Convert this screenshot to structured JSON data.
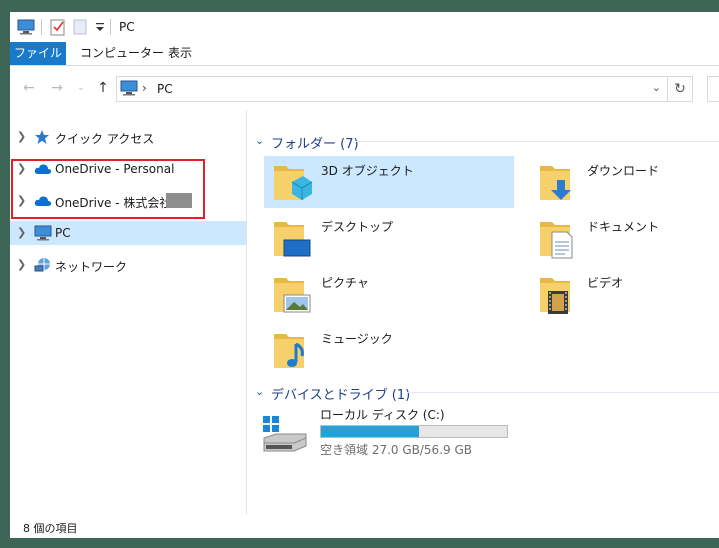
{
  "titlebar": {
    "title": "PC",
    "icons": [
      "pc-icon",
      "properties-icon",
      "new-folder-icon",
      "quick-access-toolbar-dropdown"
    ]
  },
  "ribbon": {
    "tabs": [
      {
        "label": "ファイル",
        "active": true
      },
      {
        "label": "コンピューター"
      },
      {
        "label": "表示"
      }
    ]
  },
  "address": {
    "path": "PC",
    "separator": "›"
  },
  "nav": {
    "items": [
      {
        "label": "クイック アクセス",
        "icon": "star-icon"
      },
      {
        "label": "OneDrive - Personal",
        "icon": "cloud-icon"
      },
      {
        "label": "OneDrive - 株式会社",
        "icon": "cloud-icon"
      },
      {
        "label": "PC",
        "icon": "pc-icon",
        "selected": true
      },
      {
        "label": "ネットワーク",
        "icon": "network-icon"
      }
    ]
  },
  "folders": {
    "header": "フォルダー (7)",
    "items": [
      {
        "label": "3D オブジェクト",
        "icon": "3d-objects-folder-icon",
        "selected": true
      },
      {
        "label": "ダウンロード",
        "icon": "downloads-folder-icon"
      },
      {
        "label": "デスクトップ",
        "icon": "desktop-folder-icon"
      },
      {
        "label": "ドキュメント",
        "icon": "documents-folder-icon"
      },
      {
        "label": "ピクチャ",
        "icon": "pictures-folder-icon"
      },
      {
        "label": "ビデオ",
        "icon": "videos-folder-icon"
      },
      {
        "label": "ミュージック",
        "icon": "music-folder-icon"
      }
    ]
  },
  "devices": {
    "header": "デバイスとドライブ (1)",
    "drive": {
      "label": "ローカル ディスク (C:)",
      "free_text": "空き領域 27.0 GB/56.9 GB",
      "used_fraction": 0.525
    }
  },
  "status": {
    "text": "8 個の項目"
  },
  "colors": {
    "accent": "#1979ca",
    "selection": "#cce8ff",
    "highlight_border": "#e0202a",
    "drive_bar": "#26a0da"
  }
}
